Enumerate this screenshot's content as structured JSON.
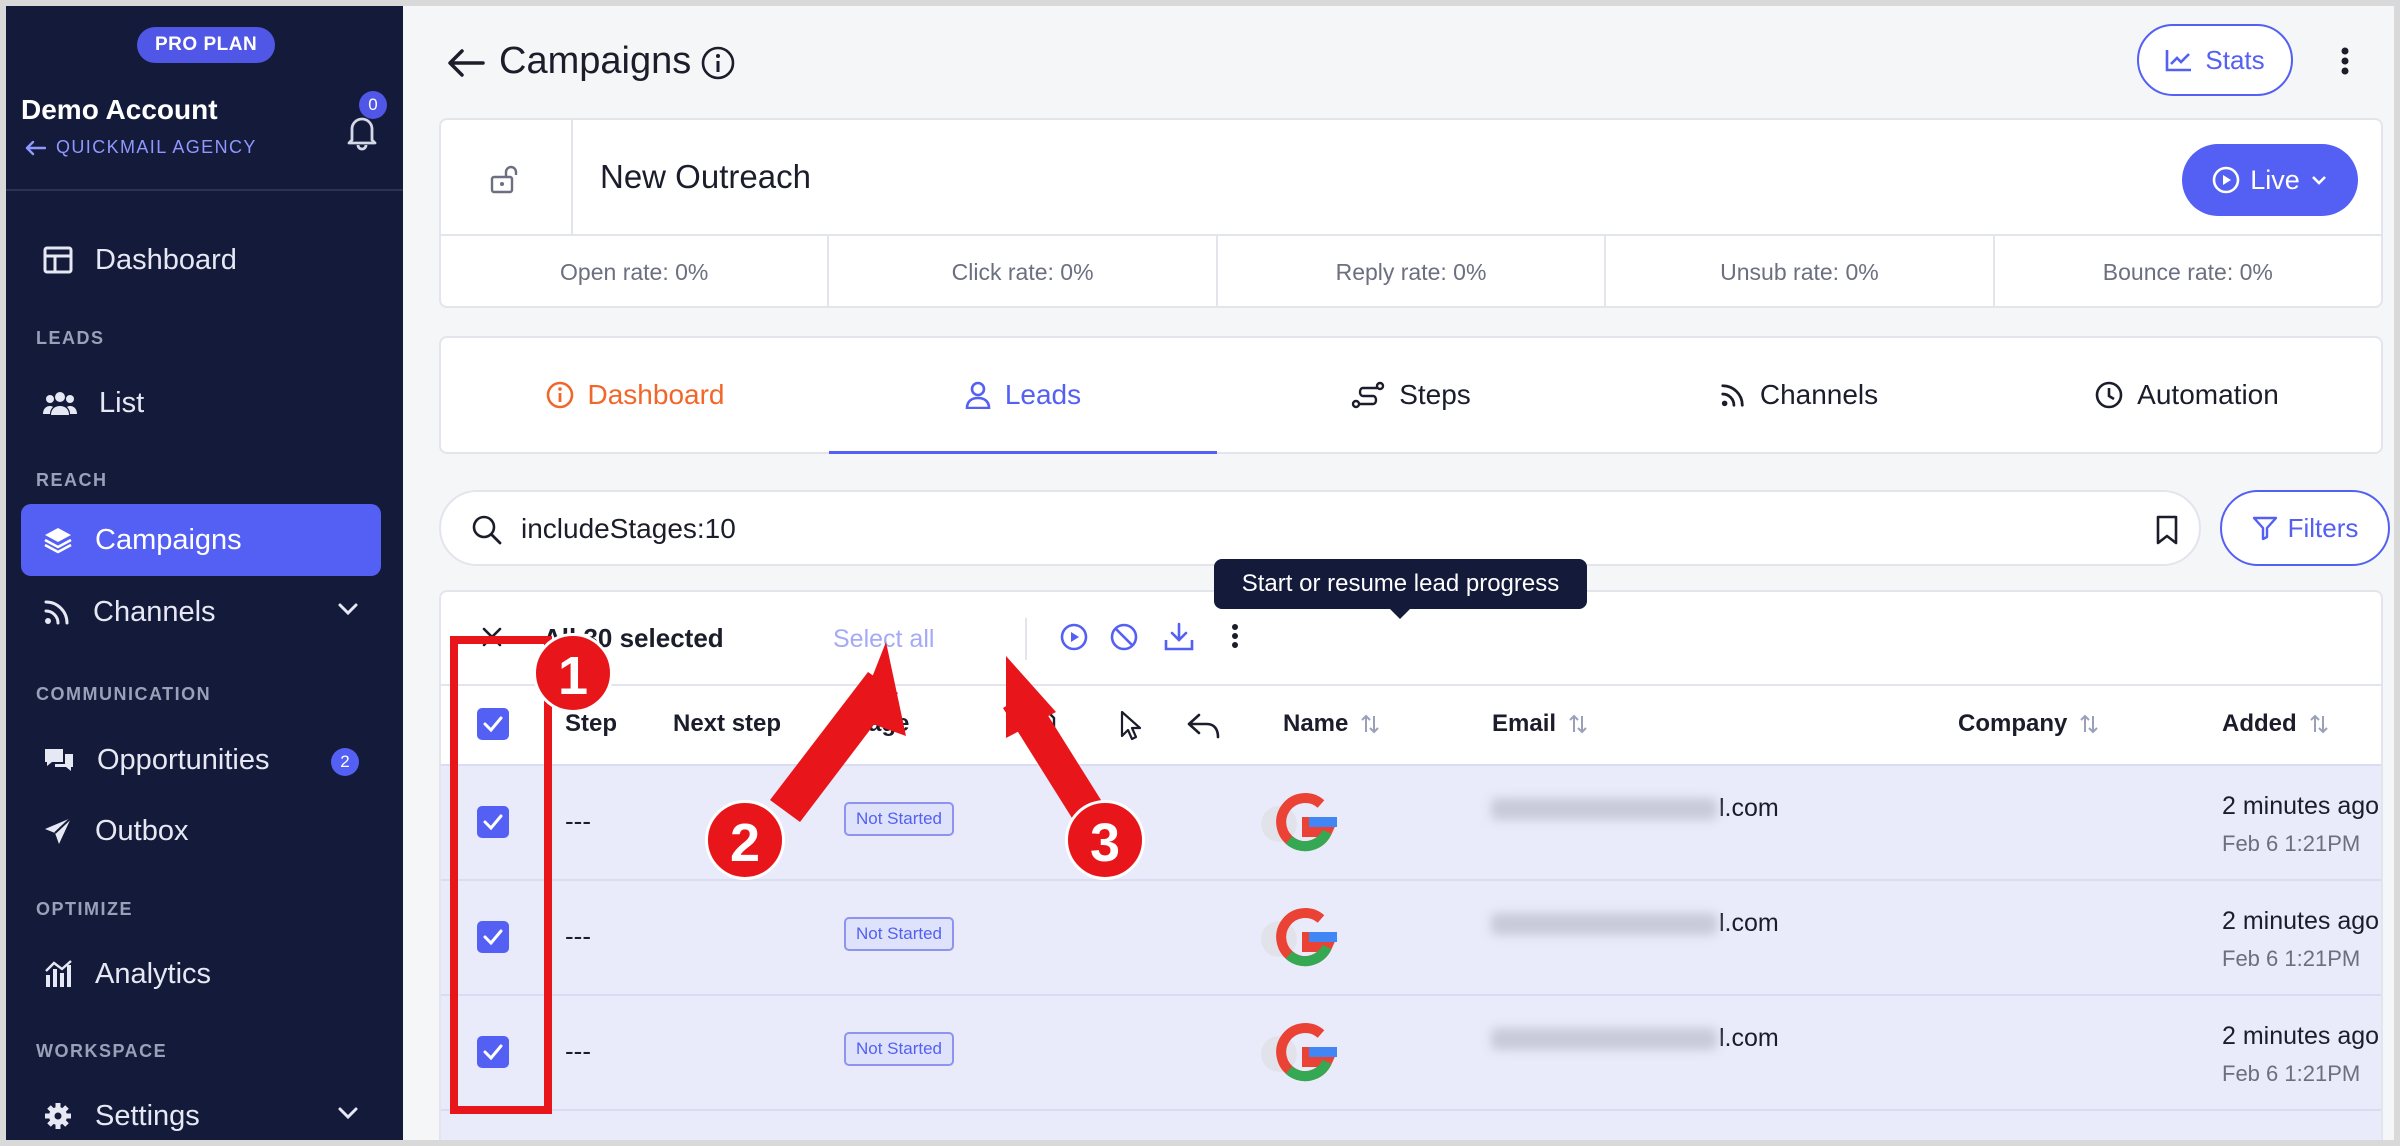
{
  "sidebar": {
    "plan": "PRO PLAN",
    "account_name": "Demo Account",
    "agency": "QUICKMAIL AGENCY",
    "notification_count": "0",
    "sections": {
      "leads": "LEADS",
      "reach": "REACH",
      "communication": "COMMUNICATION",
      "optimize": "OPTIMIZE",
      "workspace": "WORKSPACE"
    },
    "items": [
      {
        "label": "Dashboard",
        "icon": "dashboard-icon"
      },
      {
        "label": "List",
        "icon": "users-icon"
      },
      {
        "label": "Campaigns",
        "icon": "layers-icon",
        "active": true
      },
      {
        "label": "Channels",
        "icon": "rss-icon"
      },
      {
        "label": "Opportunities",
        "icon": "chat-icon",
        "count": "2"
      },
      {
        "label": "Outbox",
        "icon": "send-icon"
      },
      {
        "label": "Analytics",
        "icon": "analytics-icon"
      },
      {
        "label": "Settings",
        "icon": "gear-icon"
      }
    ]
  },
  "header": {
    "title": "Campaigns",
    "stats_label": "Stats"
  },
  "campaign": {
    "name": "New Outreach",
    "status_label": "Live",
    "rates": [
      "Open rate: 0%",
      "Click rate: 0%",
      "Reply rate: 0%",
      "Unsub rate: 0%",
      "Bounce rate: 0%"
    ]
  },
  "tabs": [
    {
      "label": "Dashboard",
      "icon": "info-icon"
    },
    {
      "label": "Leads",
      "icon": "user-icon",
      "active": true
    },
    {
      "label": "Steps",
      "icon": "steps-icon"
    },
    {
      "label": "Channels",
      "icon": "rss-icon"
    },
    {
      "label": "Automation",
      "icon": "clock-icon"
    }
  ],
  "search": {
    "value": "includeStages:10",
    "filters_label": "Filters"
  },
  "toolbar": {
    "selected_text": "All 30 selected",
    "select_all_label": "Select all",
    "tooltip": "Start or resume lead progress"
  },
  "table": {
    "columns": {
      "step": "Step",
      "next_step": "Next step",
      "stage": "Stage",
      "name": "Name",
      "email": "Email",
      "company": "Company",
      "added": "Added"
    },
    "rows": [
      {
        "step": "---",
        "stage": "Not Started",
        "email_suffix": "l.com",
        "added": "2 minutes ago",
        "date": "Feb 6 1:21PM"
      },
      {
        "step": "---",
        "stage": "Not Started",
        "email_suffix": "l.com",
        "added": "2 minutes ago",
        "date": "Feb 6 1:21PM"
      },
      {
        "step": "---",
        "stage": "Not Started",
        "email_suffix": "l.com",
        "added": "2 minutes ago",
        "date": "Feb 6 1:21PM"
      }
    ]
  },
  "annotations": [
    "1",
    "2",
    "3"
  ],
  "colors": {
    "accent": "#5360f3",
    "sidebar_bg": "#141a3a",
    "annotation_red": "#e8161b",
    "dashboard_tab": "#f2662a"
  }
}
